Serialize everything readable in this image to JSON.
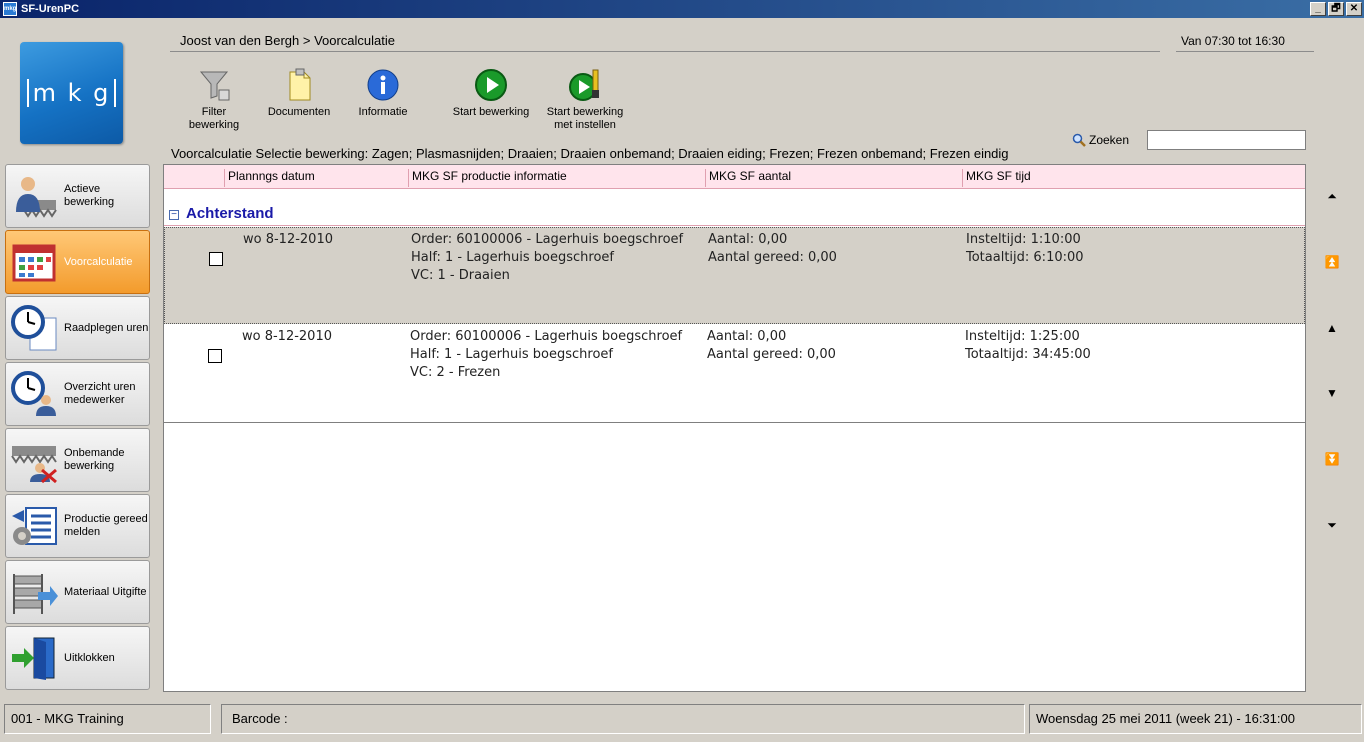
{
  "window": {
    "title": "SF-UrenPC",
    "icon_text": "mkg",
    "buttons": [
      "_",
      "🗗",
      "✕"
    ]
  },
  "logo": {
    "text": "m k g"
  },
  "sidebar": {
    "items": [
      {
        "label": "Actieve bewerking",
        "icon": "worker-saw-icon",
        "active": false
      },
      {
        "label": "Voorcalculatie",
        "icon": "calendar-icon",
        "active": true
      },
      {
        "label": "Raadplegen uren",
        "icon": "clock-doc-icon",
        "active": false
      },
      {
        "label": "Overzicht uren medewerker",
        "icon": "clock-person-icon",
        "active": false
      },
      {
        "label": "Onbemande bewerking",
        "icon": "unmanned-icon",
        "active": false
      },
      {
        "label": "Productie gereed melden",
        "icon": "production-done-icon",
        "active": false
      },
      {
        "label": "Materiaal Uitgifte",
        "icon": "material-rack-icon",
        "active": false
      },
      {
        "label": "Uitklokken",
        "icon": "clock-out-door-icon",
        "active": false
      }
    ]
  },
  "header": {
    "breadcrumb": "Joost van den Bergh > Voorcalculatie",
    "time_range": "Van 07:30 tot 16:30"
  },
  "toolbar": {
    "filter": "Filter bewerking",
    "documents": "Documenten",
    "info": "Informatie",
    "start": "Start bewerking",
    "start_setup_1": "Start bewerking",
    "start_setup_2": "met instellen"
  },
  "selection_text": "Voorcalculatie Selectie bewerking: Zagen; Plasmasnijden; Draaien; Draaien onbemand; Draaien eiding; Frezen; Frezen onbemand; Frezen eindig",
  "search": {
    "label": "Zoeken",
    "value": ""
  },
  "grid": {
    "columns": [
      "Plannngs datum",
      "MKG SF productie informatie",
      "MKG SF aantal",
      "MKG SF tijd"
    ],
    "group": {
      "toggle": "−",
      "label": "Achterstand"
    },
    "rows": [
      {
        "date": "wo 8-12-2010",
        "info": [
          "Order: 60100006 - Lagerhuis boegschroef",
          "Half: 1 - Lagerhuis boegschroef",
          "VC: 1 - Draaien"
        ],
        "qty": [
          "Aantal: 0,00",
          "Aantal gereed: 0,00"
        ],
        "time": [
          "Insteltijd: 1:10:00",
          "Totaaltijd: 6:10:00"
        ],
        "selected": true
      },
      {
        "date": "wo 8-12-2010",
        "info": [
          "Order: 60100006 - Lagerhuis boegschroef",
          "Half: 1 - Lagerhuis boegschroef",
          "VC: 2 - Frezen"
        ],
        "qty": [
          "Aantal: 0,00",
          "Aantal gereed: 0,00"
        ],
        "time": [
          "Insteltijd: 1:25:00",
          "Totaaltijd: 34:45:00"
        ],
        "selected": false
      }
    ]
  },
  "nav": [
    "⏶",
    "⏫",
    "▲",
    "▼",
    "⏬",
    "⏷"
  ],
  "status": {
    "company": "001 - MKG Training",
    "barcode_label": "Barcode :",
    "datetime": "Woensdag 25 mei 2011 (week 21)  -  16:31:00"
  }
}
